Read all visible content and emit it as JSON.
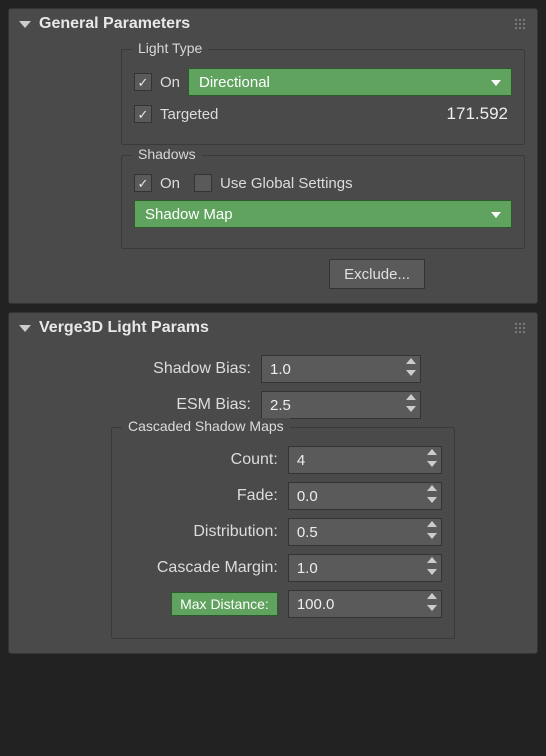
{
  "panel1": {
    "title": "General Parameters",
    "lightType": {
      "legend": "Light Type",
      "on_label": "On",
      "dropdown_value": "Directional",
      "targeted_label": "Targeted",
      "targeted_value": "171.592"
    },
    "shadows": {
      "legend": "Shadows",
      "on_label": "On",
      "global_label": "Use Global Settings",
      "dropdown_value": "Shadow Map"
    },
    "exclude_label": "Exclude..."
  },
  "panel2": {
    "title": "Verge3D Light Params",
    "shadow_bias_label": "Shadow Bias:",
    "shadow_bias_value": "1.0",
    "esm_bias_label": "ESM Bias:",
    "esm_bias_value": "2.5",
    "csm": {
      "legend": "Cascaded Shadow Maps",
      "count_label": "Count:",
      "count_value": "4",
      "fade_label": "Fade:",
      "fade_value": "0.0",
      "distribution_label": "Distribution:",
      "distribution_value": "0.5",
      "cascade_margin_label": "Cascade Margin:",
      "cascade_margin_value": "1.0",
      "max_distance_label": "Max Distance:",
      "max_distance_value": "100.0"
    }
  }
}
